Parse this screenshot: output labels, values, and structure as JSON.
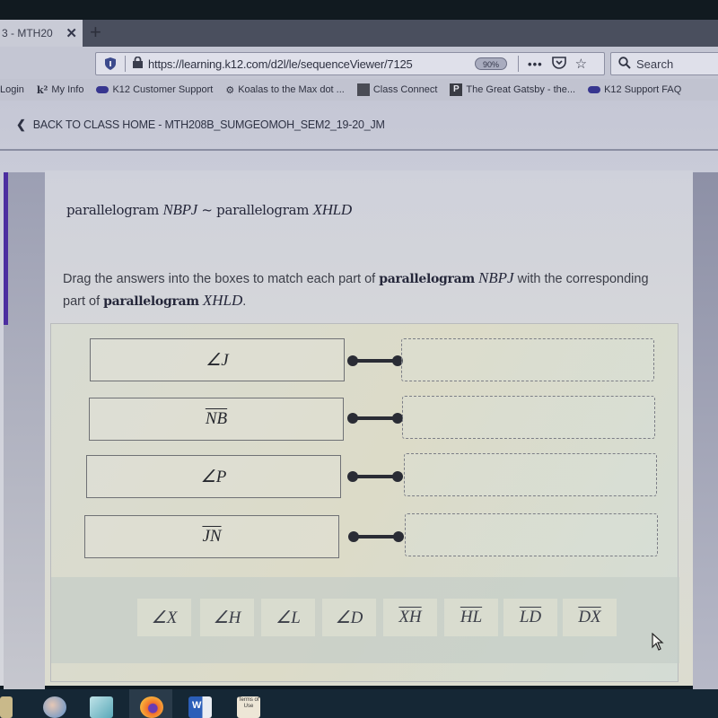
{
  "browser": {
    "tab_title": "3 - MTH20",
    "tab_close_icon": "close-icon",
    "new_tab_icon": "plus-icon",
    "url": "https://learning.k12.com/d2l/le/sequenceViewer/7125",
    "zoom_level": "90%",
    "search_placeholder": "Search",
    "bookmarks": [
      {
        "label": "Login",
        "icon": ""
      },
      {
        "label": "My Info",
        "icon": "k12-logo-icon"
      },
      {
        "label": "K12 Customer Support",
        "icon": "cloud-icon"
      },
      {
        "label": "Koalas to the Max dot ...",
        "icon": "gear-icon"
      },
      {
        "label": "Class Connect",
        "icon": "class-connect-icon"
      },
      {
        "label": "The Great Gatsby - the...",
        "icon": "p-icon"
      },
      {
        "label": "K12 Support FAQ",
        "icon": "cloud-icon"
      }
    ]
  },
  "page": {
    "back_link": "BACK TO CLASS HOME - MTH208B_SUMGEOMOH_SEM2_19-20_JM",
    "heading": {
      "word1": "parallelogram",
      "name1": "NBPJ",
      "similar": "~",
      "word2": "parallelogram",
      "name2": "XHLD"
    },
    "instructions": {
      "text1": "Drag the answers into the boxes to match each part of",
      "bold1": "parallelogram",
      "name1": "NBPJ",
      "text2": "with the corresponding part of",
      "bold2": "parallelogram",
      "name2": "XHLD",
      "end": "."
    },
    "prompts": [
      {
        "label": "∠J",
        "type": "angle"
      },
      {
        "label": "NB",
        "type": "segment"
      },
      {
        "label": "∠P",
        "type": "angle"
      },
      {
        "label": "JN",
        "type": "segment"
      }
    ],
    "drop_zones": [
      "",
      "",
      "",
      ""
    ],
    "answers": [
      {
        "label": "∠X",
        "type": "angle"
      },
      {
        "label": "∠H",
        "type": "angle"
      },
      {
        "label": "∠L",
        "type": "angle"
      },
      {
        "label": "∠D",
        "type": "angle"
      },
      {
        "label": "XH",
        "type": "segment"
      },
      {
        "label": "HL",
        "type": "segment"
      },
      {
        "label": "LD",
        "type": "segment"
      },
      {
        "label": "DX",
        "type": "segment"
      }
    ]
  },
  "taskbar": {
    "apps": [
      "file-explorer-icon",
      "media-icon",
      "store-icon",
      "firefox-icon",
      "word-icon",
      "terms-of-use-icon"
    ],
    "terms_label": "Terms of Use"
  }
}
